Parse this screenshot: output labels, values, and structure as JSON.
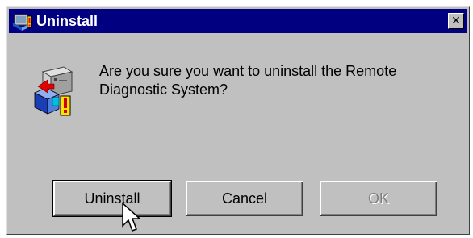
{
  "window": {
    "title": "Uninstall",
    "close_symbol": "✕",
    "icon": "setup-computer-icon"
  },
  "dialog": {
    "message": "Are you sure you want to uninstall the Remote Diagnostic System?",
    "message_icon": "uninstall-computer-icon"
  },
  "buttons": {
    "uninstall_label": "Uninstall",
    "cancel_label": "Cancel",
    "ok_label": "OK",
    "ok_enabled": false
  },
  "pointer": "arrow-cursor-icon",
  "colors": {
    "titlebar": "#000080",
    "dialog_face": "#c0c0c0",
    "disabled_text": "#808080"
  }
}
